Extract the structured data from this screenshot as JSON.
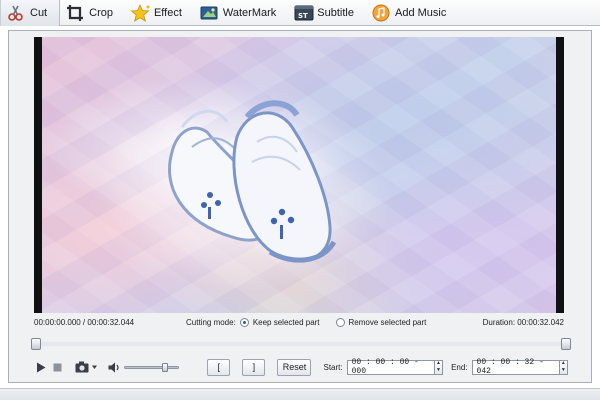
{
  "tabs": [
    {
      "label": "Cut",
      "icon": "scissors-icon",
      "active": true
    },
    {
      "label": "Crop",
      "icon": "crop-icon",
      "active": false
    },
    {
      "label": "Effect",
      "icon": "effect-star-icon",
      "active": false
    },
    {
      "label": "WaterMark",
      "icon": "watermark-icon",
      "active": false
    },
    {
      "label": "Subtitle",
      "icon": "subtitle-icon",
      "active": false
    },
    {
      "label": "Add Music",
      "icon": "add-music-icon",
      "active": false
    }
  ],
  "info": {
    "position_time": "00:00:00.000 / 00:00:32.044",
    "cutting_mode_label": "Cutting mode:",
    "keep_label": "Keep selected part",
    "remove_label": "Remove selected part",
    "selected_mode": "keep",
    "duration_text": "Duration: 00:00:32.042"
  },
  "controls": {
    "volume_level": 0.78,
    "mark_start_label": "[",
    "mark_end_label": "]",
    "reset_label": "Reset",
    "start_label": "Start:",
    "start_value": "00 : 00 : 00 - 000",
    "end_label": "End:",
    "end_value": "00 : 00 : 32 - 042"
  },
  "colors": {
    "accent_blue": "#2c5aa8",
    "panel_bg": "#f0f1f3",
    "tab_active_bg": "#dfe4ea"
  }
}
